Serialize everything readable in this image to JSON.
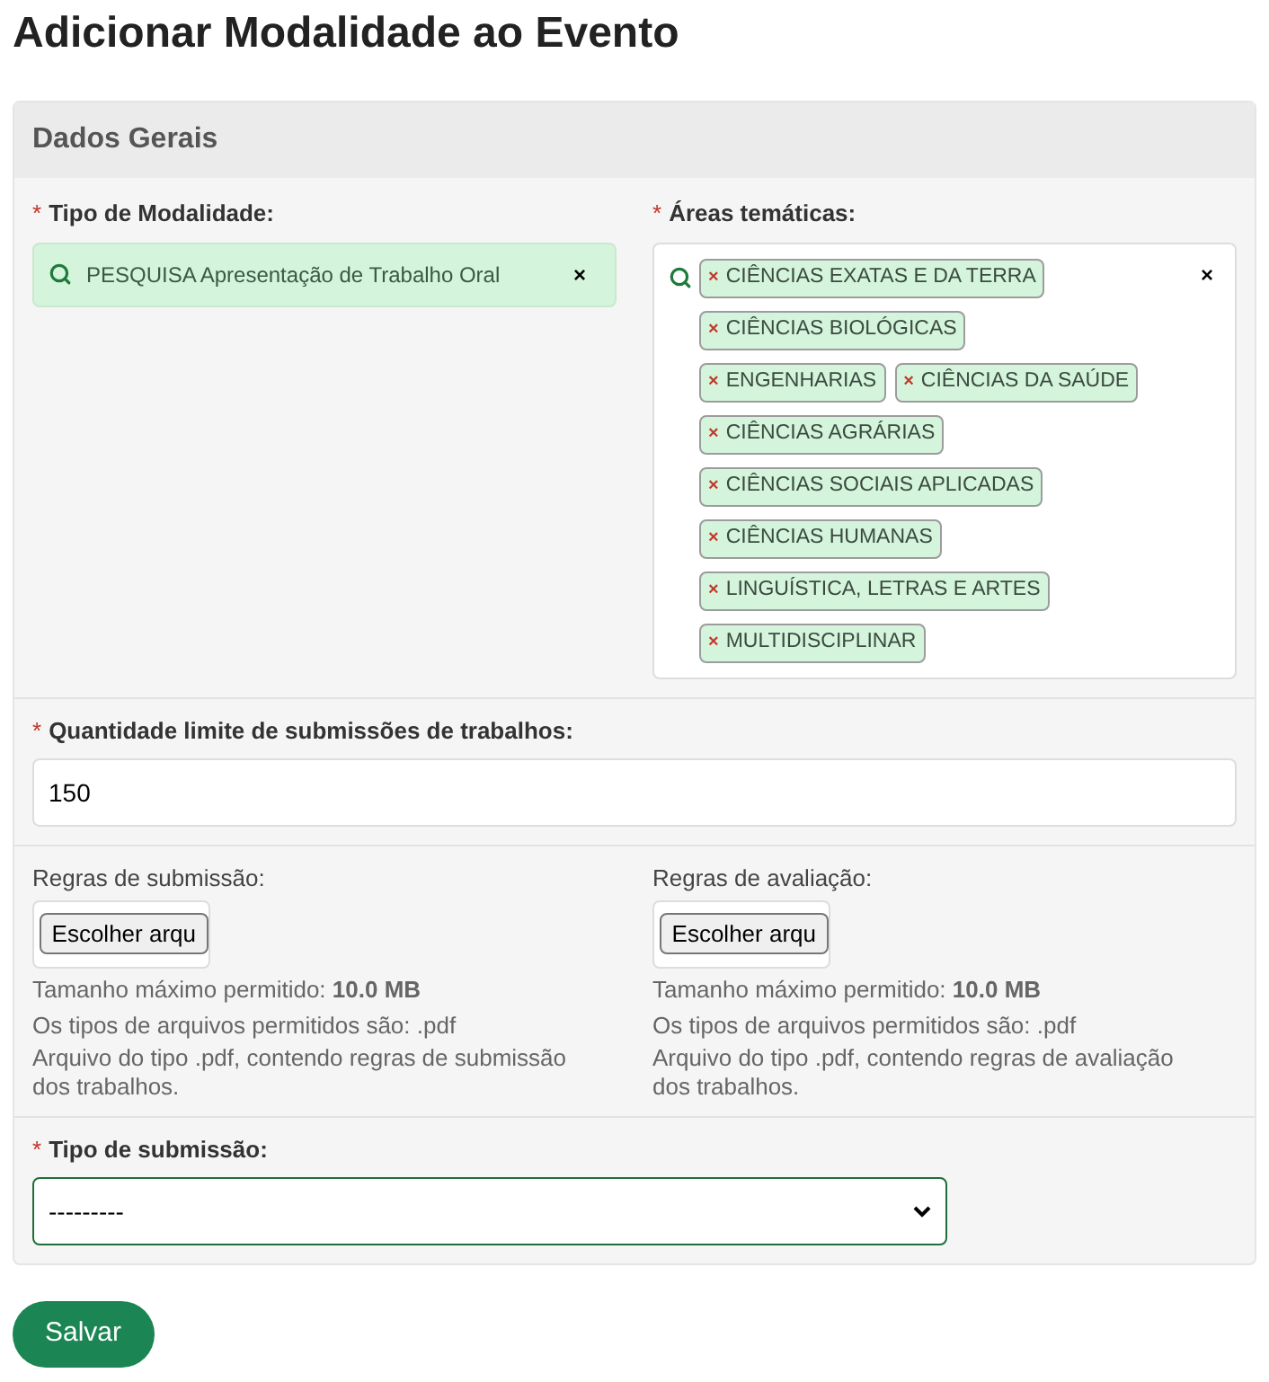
{
  "title": "Adicionar Modalidade ao Evento",
  "panel": {
    "heading": "Dados Gerais"
  },
  "required_mark": "*",
  "modalidade": {
    "label": "Tipo de Modalidade:",
    "value": "PESQUISA Apresentação de Trabalho Oral",
    "clear": "×"
  },
  "areas": {
    "label": "Áreas temáticas:",
    "clear": "×",
    "remove": "×",
    "tags": [
      {
        "label": "CIÊNCIAS EXATAS E DA TERRA"
      },
      {
        "label": "CIÊNCIAS BIOLÓGICAS"
      },
      {
        "label": "ENGENHARIAS"
      },
      {
        "label": "CIÊNCIAS DA SAÚDE"
      },
      {
        "label": "CIÊNCIAS AGRÁRIAS"
      },
      {
        "label": "CIÊNCIAS SOCIAIS APLICADAS"
      },
      {
        "label": "CIÊNCIAS HUMANAS"
      },
      {
        "label": "LINGUÍSTICA, LETRAS E ARTES"
      },
      {
        "label": "MULTIDISCIPLINAR"
      }
    ]
  },
  "limite": {
    "label": "Quantidade limite de submissões de trabalhos:",
    "value": "150"
  },
  "files": [
    {
      "label": "Regras de submissão:",
      "button": "Escolher arqu",
      "size": "Tamanho máximo permitido: **10.0 MB**",
      "types": "Os tipos de arquivos permitidos são: .pdf",
      "help": "Arquivo do tipo .pdf, contendo regras de submissão dos trabalhos."
    },
    {
      "label": "Regras de avaliação:",
      "button": "Escolher arqu",
      "size": "Tamanho máximo permitido: **10.0 MB**",
      "types": "Os tipos de arquivos permitidos são: .pdf",
      "help": "Arquivo do tipo .pdf, contendo regras de avaliação dos trabalhos."
    }
  ],
  "submissao": {
    "label": "Tipo de submissão:",
    "value": "---------"
  },
  "save": "Salvar"
}
